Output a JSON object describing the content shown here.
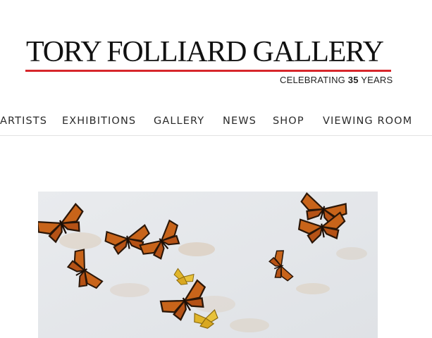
{
  "header": {
    "logo_text": "TORY FOLLIARD GALLERY",
    "tagline_prefix": "CELEBRATING",
    "tagline_number": "35",
    "tagline_suffix": "YEARS",
    "accent_color": "#d7262b"
  },
  "nav": {
    "items": [
      {
        "label": "ARTISTS"
      },
      {
        "label": "EXHIBITIONS"
      },
      {
        "label": "GALLERY"
      },
      {
        "label": "NEWS"
      },
      {
        "label": "SHOP"
      },
      {
        "label": "VIEWING ROOM"
      }
    ]
  },
  "main": {
    "artwork": {
      "subject": "monarch butterflies watercolor painting"
    }
  }
}
